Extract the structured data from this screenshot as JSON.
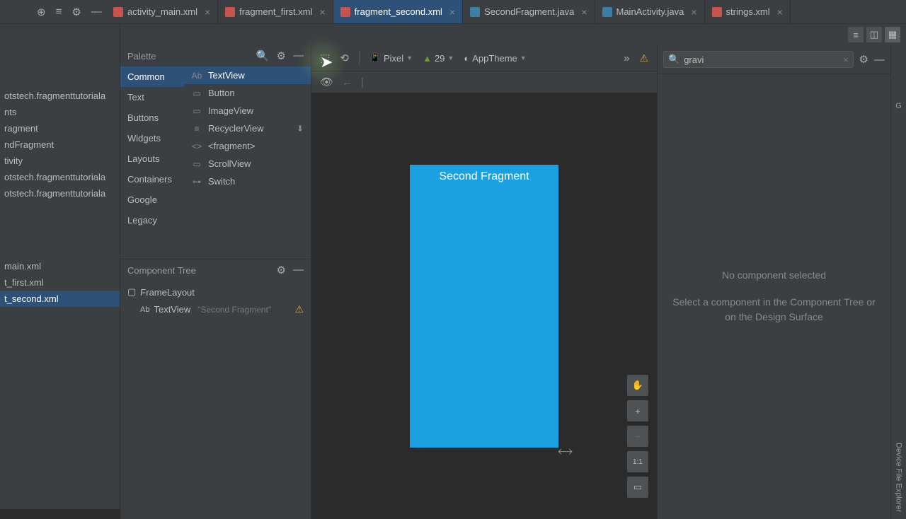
{
  "tabs": [
    {
      "label": "activity_main.xml",
      "type": "xml"
    },
    {
      "label": "fragment_first.xml",
      "type": "xml"
    },
    {
      "label": "fragment_second.xml",
      "type": "xml"
    },
    {
      "label": "SecondFragment.java",
      "type": "java"
    },
    {
      "label": "MainActivity.java",
      "type": "java"
    },
    {
      "label": "strings.xml",
      "type": "xml"
    }
  ],
  "project": {
    "items": [
      "otstech.fragmenttutoriala",
      "nts",
      "ragment",
      "ndFragment",
      "tivity",
      "otstech.fragmenttutoriala",
      "otstech.fragmenttutoriala"
    ],
    "files": [
      "main.xml",
      "t_first.xml",
      "t_second.xml"
    ]
  },
  "palette": {
    "title": "Palette",
    "categories": [
      "Common",
      "Text",
      "Buttons",
      "Widgets",
      "Layouts",
      "Containers",
      "Google",
      "Legacy"
    ],
    "items": [
      "TextView",
      "Button",
      "ImageView",
      "RecyclerView",
      "<fragment>",
      "ScrollView",
      "Switch"
    ]
  },
  "componentTree": {
    "title": "Component Tree",
    "root": "FrameLayout",
    "child": "TextView",
    "childText": "\"Second Fragment\""
  },
  "designToolbar": {
    "device": "Pixel",
    "api": "29",
    "theme": "AppTheme"
  },
  "preview": {
    "text": "Second Fragment"
  },
  "attributes": {
    "search": "gravi",
    "empty1": "No component selected",
    "empty2": "Select a component in the Component Tree or on the Design Surface"
  },
  "zoom": {
    "oneToOne": "1:1"
  },
  "rightRail": {
    "label": "Device File Explorer"
  }
}
